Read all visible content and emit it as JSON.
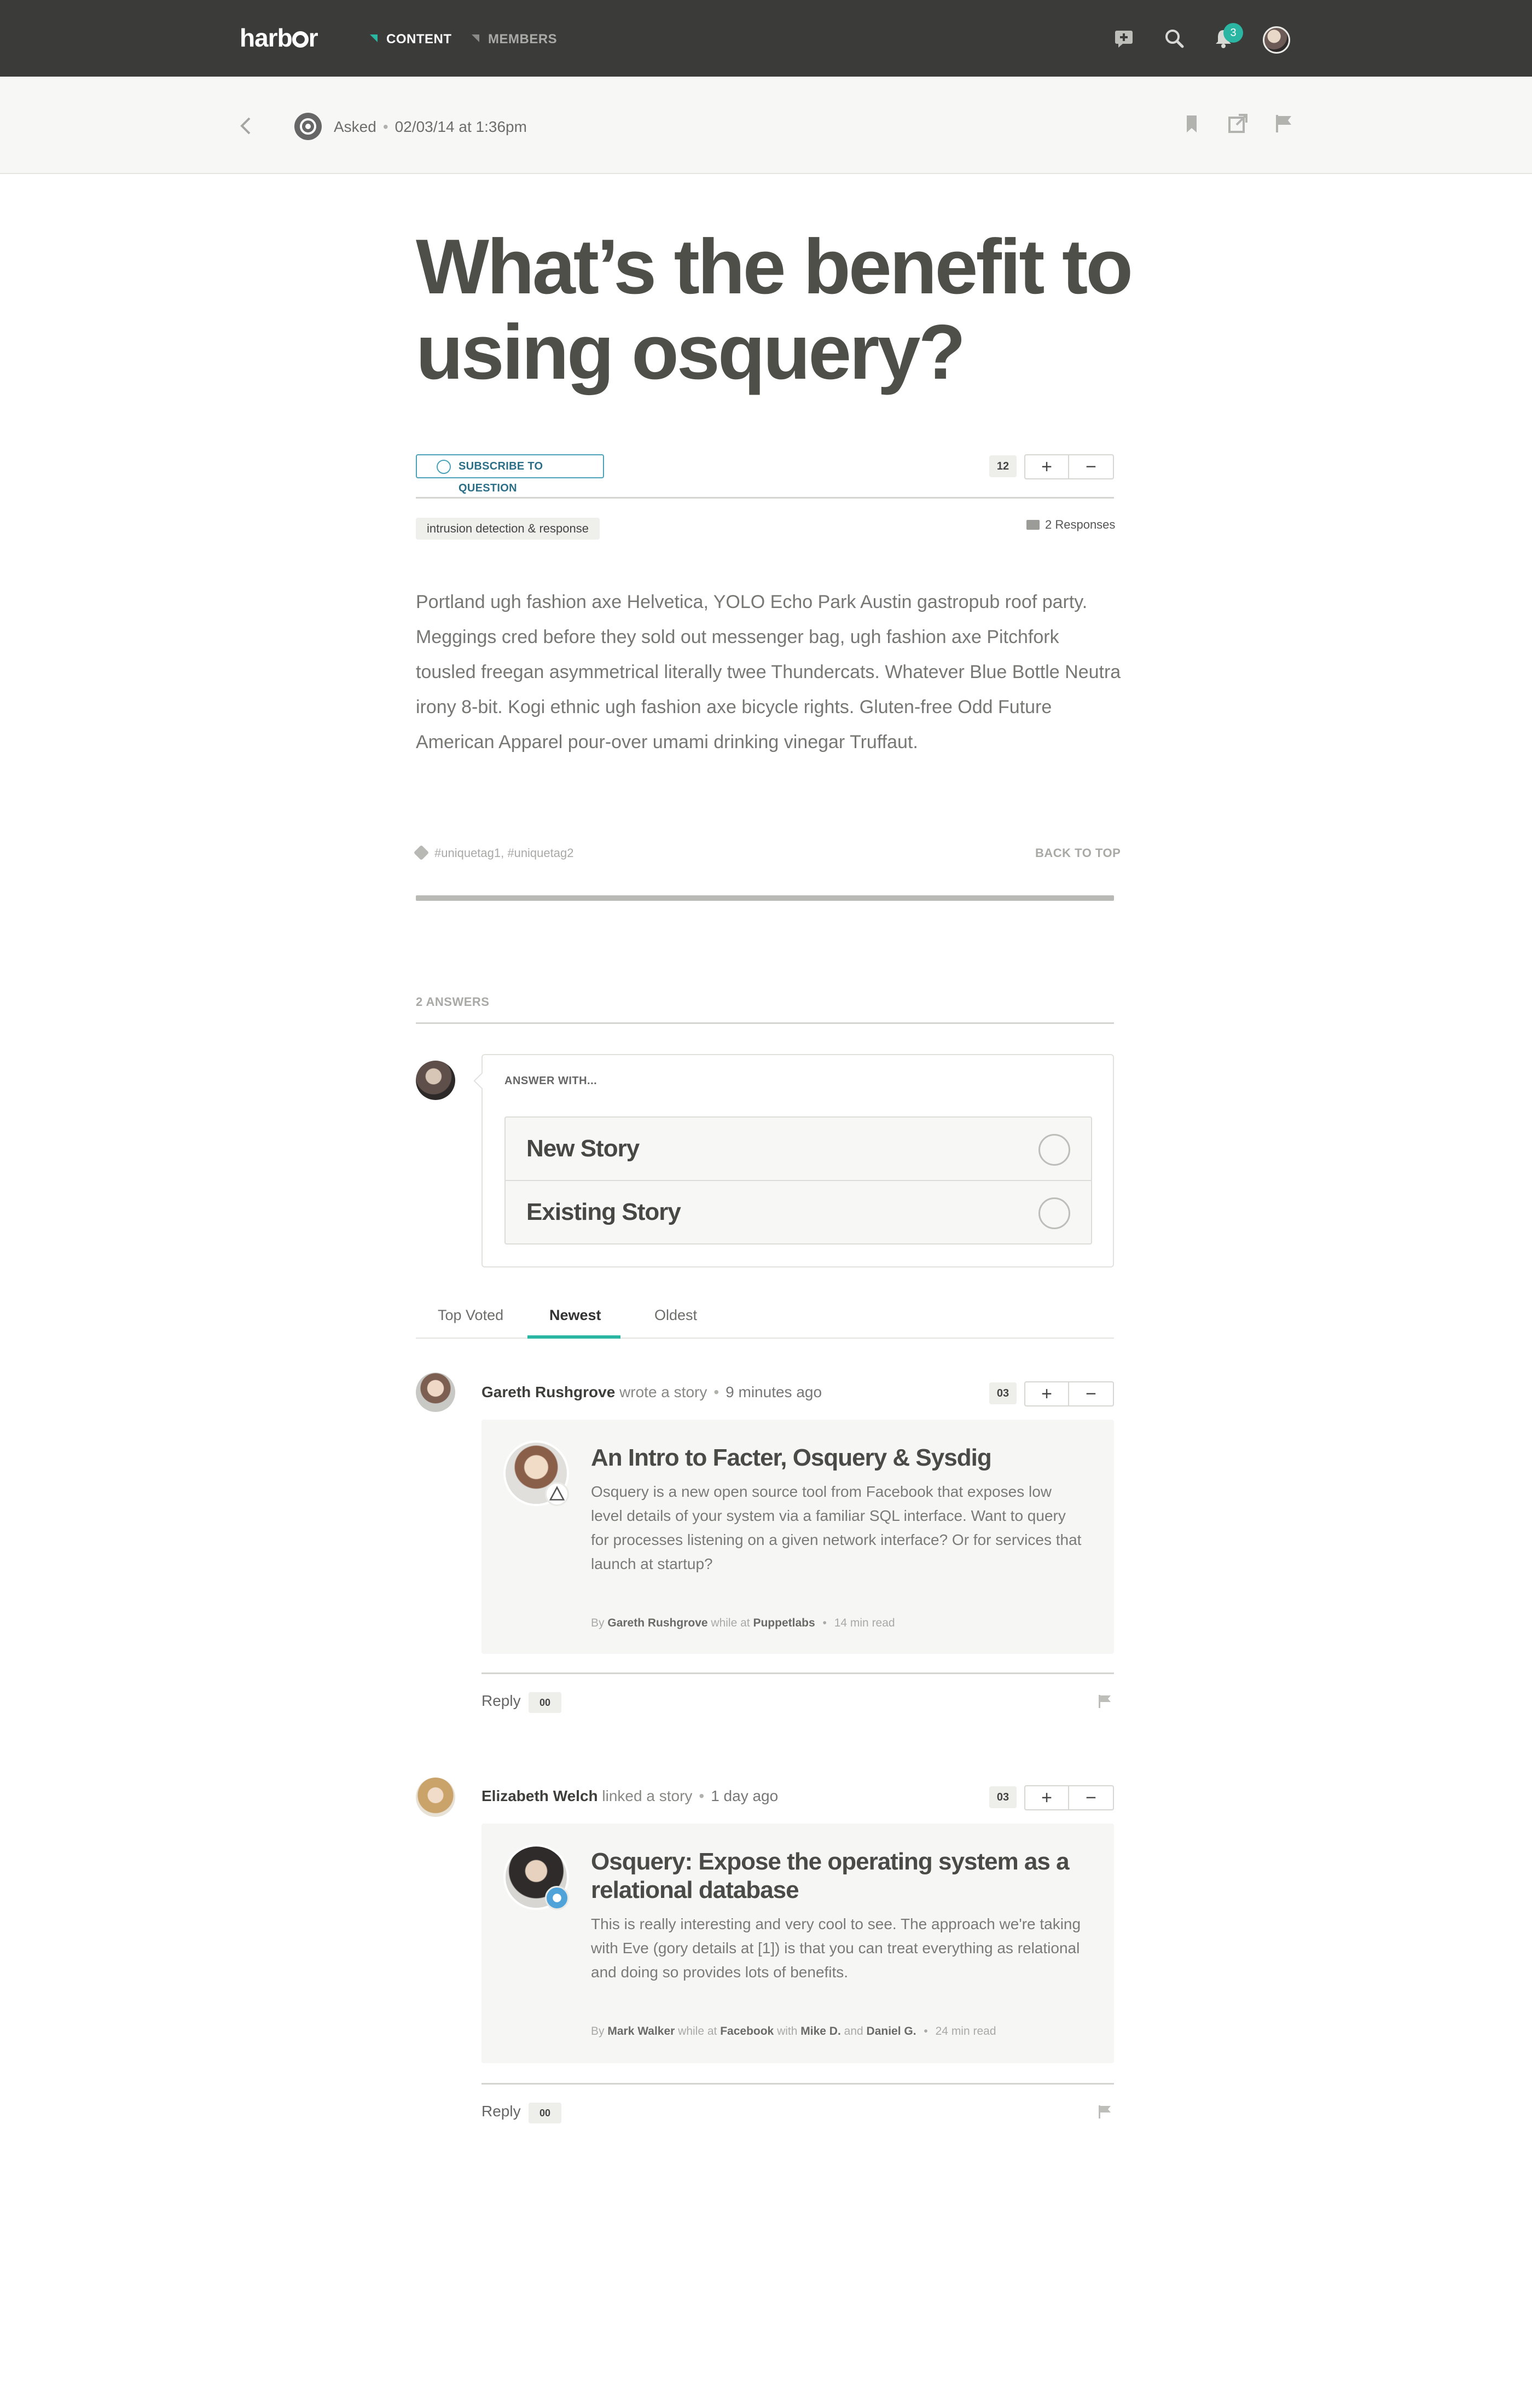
{
  "nav": {
    "logo": "harbor",
    "items": [
      {
        "label": "CONTENT",
        "active": true
      },
      {
        "label": "MEMBERS",
        "active": false
      }
    ],
    "notification_count": "3"
  },
  "subheader": {
    "asked_label": "Asked",
    "asked_date": "02/03/14 at 1:36pm"
  },
  "question": {
    "title": "What’s the benefit to using osquery?",
    "subscribe_label": "SUBSCRIBE TO QUESTION",
    "vote_count": "12",
    "topic": "intrusion detection & response",
    "responses": "2 Responses",
    "body": "Portland ugh fashion axe Helvetica, YOLO Echo Park Austin gastropub roof party. Meggings cred before they sold out messenger bag, ugh fashion axe Pitchfork tousled freegan asymmetrical literally twee Thundercats. Whatever Blue Bottle Neutra irony 8-bit. Kogi ethnic ugh fashion axe bicycle rights. Gluten-free Odd Future American Apparel pour-over umami drinking vinegar Truffaut.",
    "hashtags": "#uniquetag1, #uniquetag2",
    "back_to_top": "BACK TO TOP"
  },
  "answers": {
    "count_label": "2 ANSWERS",
    "answer_with": "ANSWER WITH...",
    "options": [
      "New Story",
      "Existing Story"
    ],
    "tabs": [
      "Top Voted",
      "Newest",
      "Oldest"
    ],
    "active_tab": "Newest",
    "items": [
      {
        "author": "Gareth Rushgrove",
        "action": "wrote a story",
        "time": "9 minutes ago",
        "votes": "03",
        "story_title": "An Intro to Facter, Osquery & Sysdig",
        "story_body": "Osquery is a new open source tool from Facebook that exposes low level details of your system via a familiar SQL interface. Want to query for processes listening on a given network interface? Or for services that launch at startup?",
        "byline_by": "By",
        "byline_author": "Gareth Rushgrove",
        "byline_while": "while at",
        "byline_org": "Puppetlabs",
        "read_time": "14 min read",
        "reply_label": "Reply",
        "reply_count": "00"
      },
      {
        "author": "Elizabeth Welch",
        "action": "linked a story",
        "time": "1 day ago",
        "votes": "03",
        "story_title": "Osquery: Expose the operating system as a relational database",
        "story_body": "This is really interesting and very cool to see. The approach we're taking with Eve (gory details at [1]) is that you can treat everything as relational and doing so provides lots of benefits.",
        "byline_by": "By",
        "byline_author": "Mark Walker",
        "byline_while": "while at",
        "byline_org": "Facebook",
        "byline_with": "with",
        "byline_co1": "Mike D.",
        "byline_and": "and",
        "byline_co2": "Daniel G.",
        "read_time": "24 min read",
        "reply_label": "Reply",
        "reply_count": "00"
      }
    ]
  }
}
